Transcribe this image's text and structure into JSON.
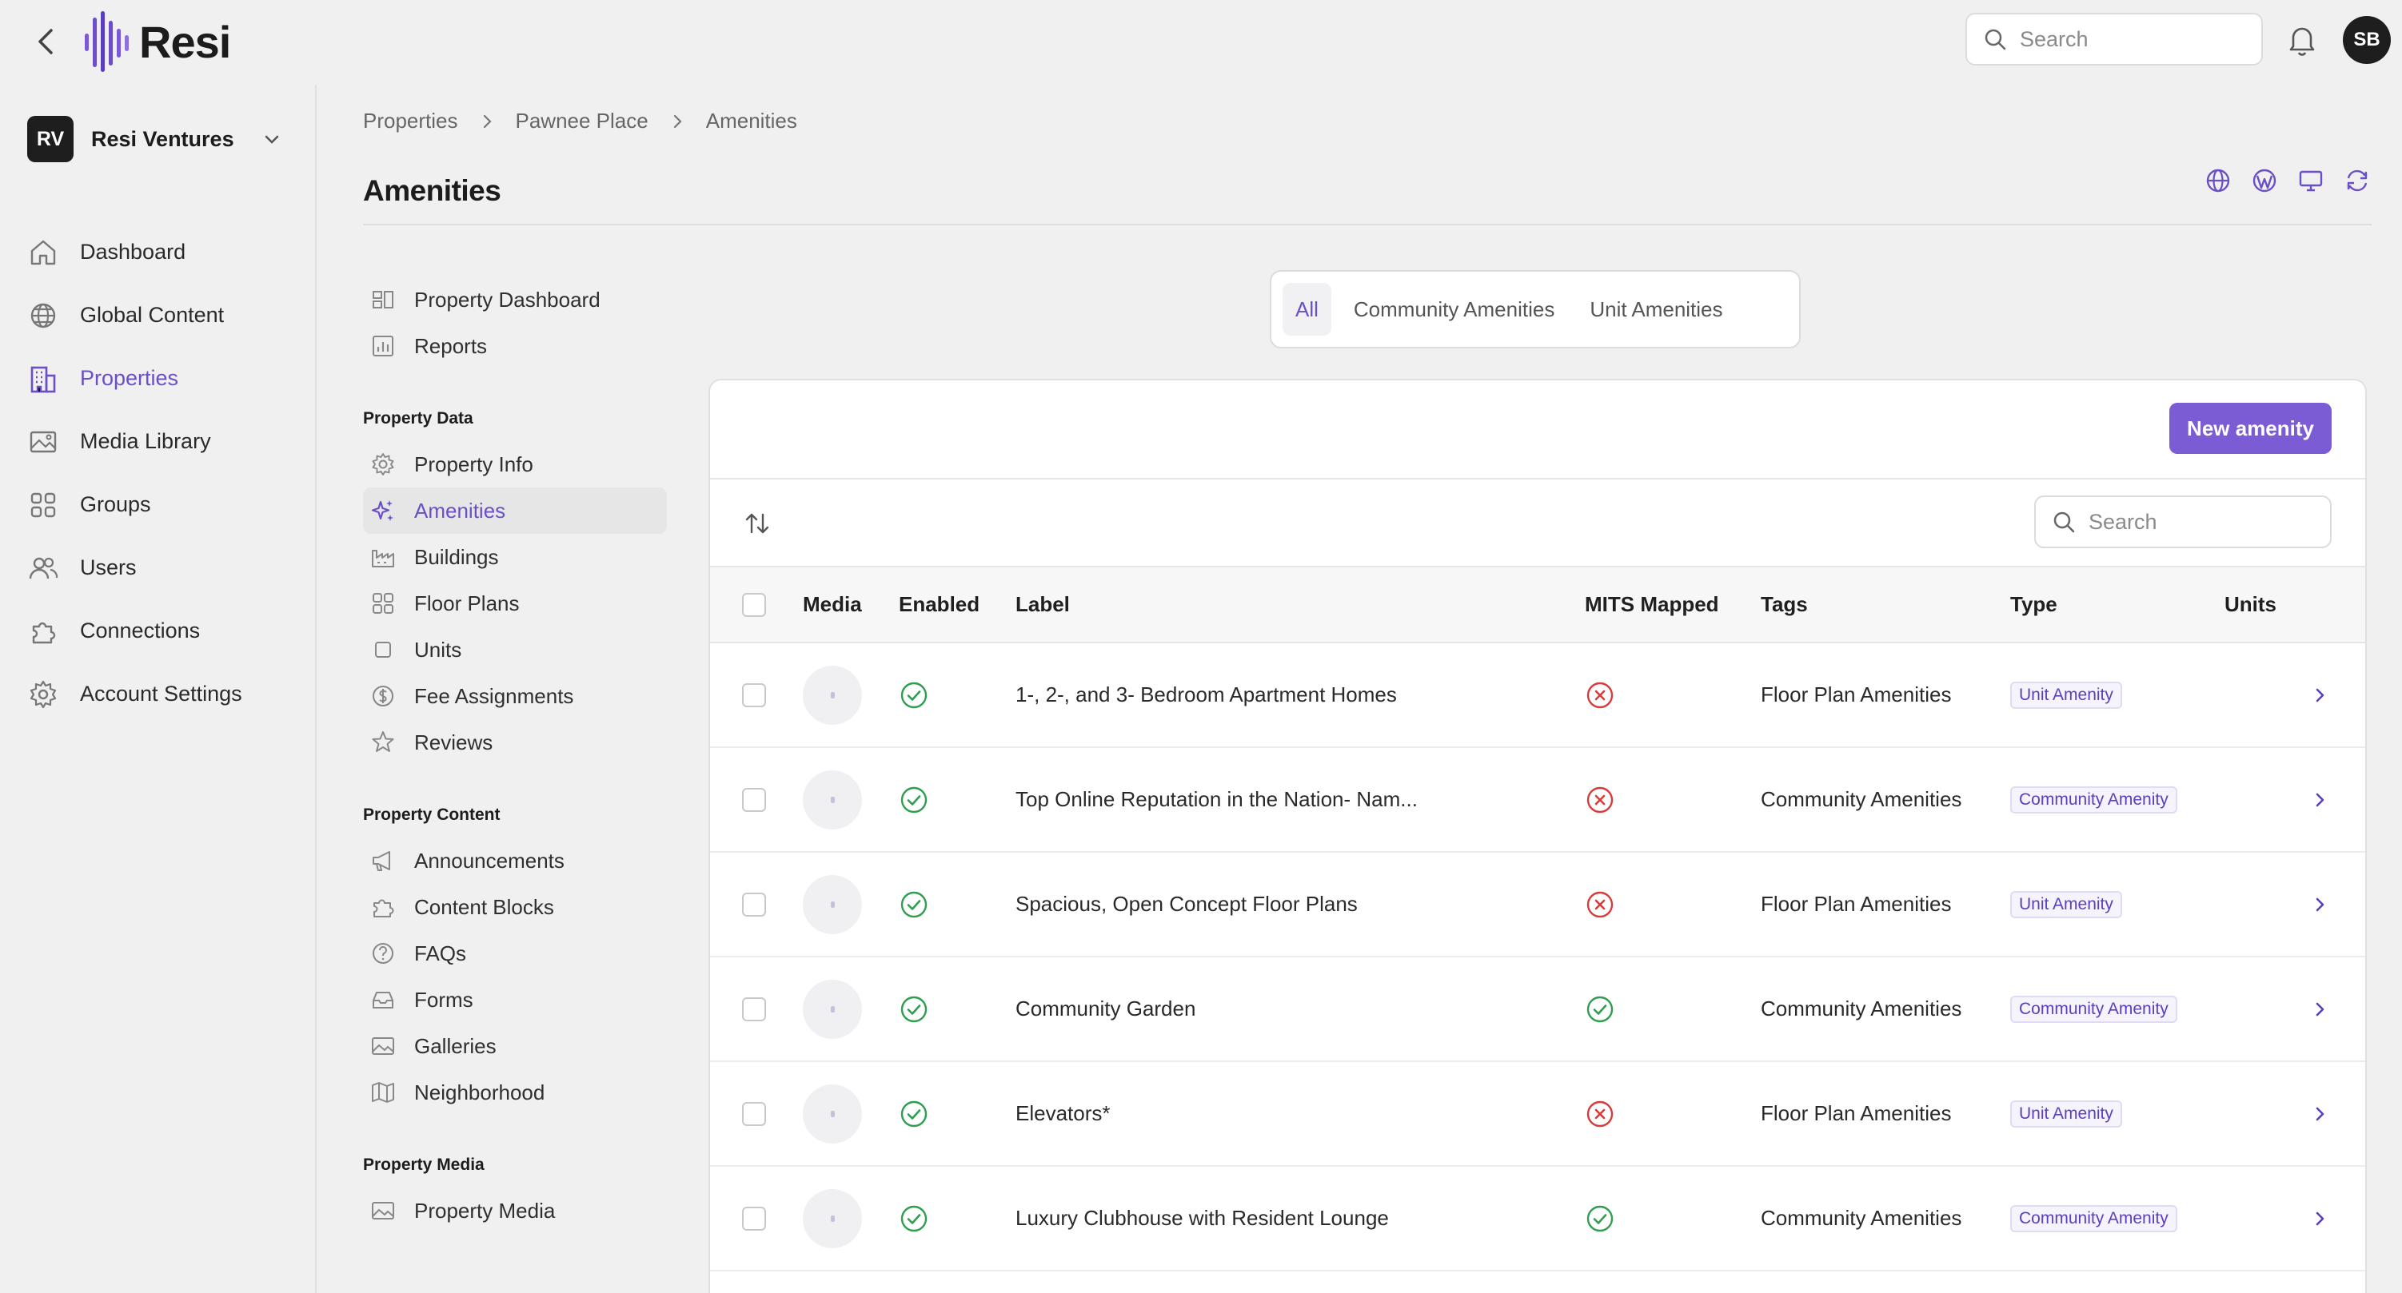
{
  "app": {
    "brand": "Resi",
    "search_placeholder": "Search",
    "user_initials": "SB"
  },
  "colors": {
    "accent": "#6a4fc6",
    "button": "#7b5cd4",
    "success": "#2e9e4f",
    "danger": "#d93a3a"
  },
  "sidebar": {
    "org_initials": "RV",
    "org_name": "Resi Ventures",
    "items": [
      {
        "label": "Dashboard",
        "icon": "home-icon",
        "active": false
      },
      {
        "label": "Global Content",
        "icon": "globe-icon",
        "active": false
      },
      {
        "label": "Properties",
        "icon": "building-icon",
        "active": true
      },
      {
        "label": "Media Library",
        "icon": "image-icon",
        "active": false
      },
      {
        "label": "Groups",
        "icon": "grid-icon",
        "active": false
      },
      {
        "label": "Users",
        "icon": "users-icon",
        "active": false
      },
      {
        "label": "Connections",
        "icon": "puzzle-icon",
        "active": false
      },
      {
        "label": "Account Settings",
        "icon": "gear-icon",
        "active": false
      }
    ]
  },
  "breadcrumb": [
    "Properties",
    "Pawnee Place",
    "Amenities"
  ],
  "page": {
    "title": "Amenities"
  },
  "subnav": {
    "top": [
      {
        "label": "Property Dashboard",
        "icon": "dashboard-icon"
      },
      {
        "label": "Reports",
        "icon": "chart-icon"
      }
    ],
    "sections": [
      {
        "title": "Property Data",
        "items": [
          {
            "label": "Property Info",
            "icon": "gear-icon",
            "active": false
          },
          {
            "label": "Amenities",
            "icon": "sparkle-icon",
            "active": true
          },
          {
            "label": "Buildings",
            "icon": "factory-icon",
            "active": false
          },
          {
            "label": "Floor Plans",
            "icon": "grid-icon",
            "active": false
          },
          {
            "label": "Units",
            "icon": "square-icon",
            "active": false
          },
          {
            "label": "Fee Assignments",
            "icon": "dollar-icon",
            "active": false
          },
          {
            "label": "Reviews",
            "icon": "star-icon",
            "active": false
          }
        ]
      },
      {
        "title": "Property Content",
        "items": [
          {
            "label": "Announcements",
            "icon": "megaphone-icon",
            "active": false
          },
          {
            "label": "Content Blocks",
            "icon": "puzzle-icon",
            "active": false
          },
          {
            "label": "FAQs",
            "icon": "question-icon",
            "active": false
          },
          {
            "label": "Forms",
            "icon": "inbox-icon",
            "active": false
          },
          {
            "label": "Galleries",
            "icon": "image-icon",
            "active": false
          },
          {
            "label": "Neighborhood",
            "icon": "map-icon",
            "active": false
          }
        ]
      },
      {
        "title": "Property Media",
        "items": [
          {
            "label": "Property Media",
            "icon": "image-icon",
            "active": false
          }
        ]
      }
    ]
  },
  "tabs": [
    {
      "label": "All",
      "active": true
    },
    {
      "label": "Community Amenities",
      "active": false
    },
    {
      "label": "Unit Amenities",
      "active": false
    }
  ],
  "card": {
    "new_button": "New amenity",
    "search_placeholder": "Search"
  },
  "table": {
    "columns": [
      "Media",
      "Enabled",
      "Label",
      "MITS Mapped",
      "Tags",
      "Type",
      "Units"
    ],
    "rows": [
      {
        "enabled": true,
        "label": "1-, 2-, and 3- Bedroom Apartment Homes",
        "mits": false,
        "tags": "Floor Plan Amenities",
        "type": "Unit Amenity"
      },
      {
        "enabled": true,
        "label": "Top Online Reputation in the Nation- Nam...",
        "mits": false,
        "tags": "Community Amenities",
        "type": "Community Amenity"
      },
      {
        "enabled": true,
        "label": "Spacious, Open Concept Floor Plans",
        "mits": false,
        "tags": "Floor Plan Amenities",
        "type": "Unit Amenity"
      },
      {
        "enabled": true,
        "label": "Community Garden",
        "mits": true,
        "tags": "Community Amenities",
        "type": "Community Amenity"
      },
      {
        "enabled": true,
        "label": "Elevators*",
        "mits": false,
        "tags": "Floor Plan Amenities",
        "type": "Unit Amenity"
      },
      {
        "enabled": true,
        "label": "Luxury Clubhouse with Resident Lounge",
        "mits": true,
        "tags": "Community Amenities",
        "type": "Community Amenity"
      }
    ]
  }
}
